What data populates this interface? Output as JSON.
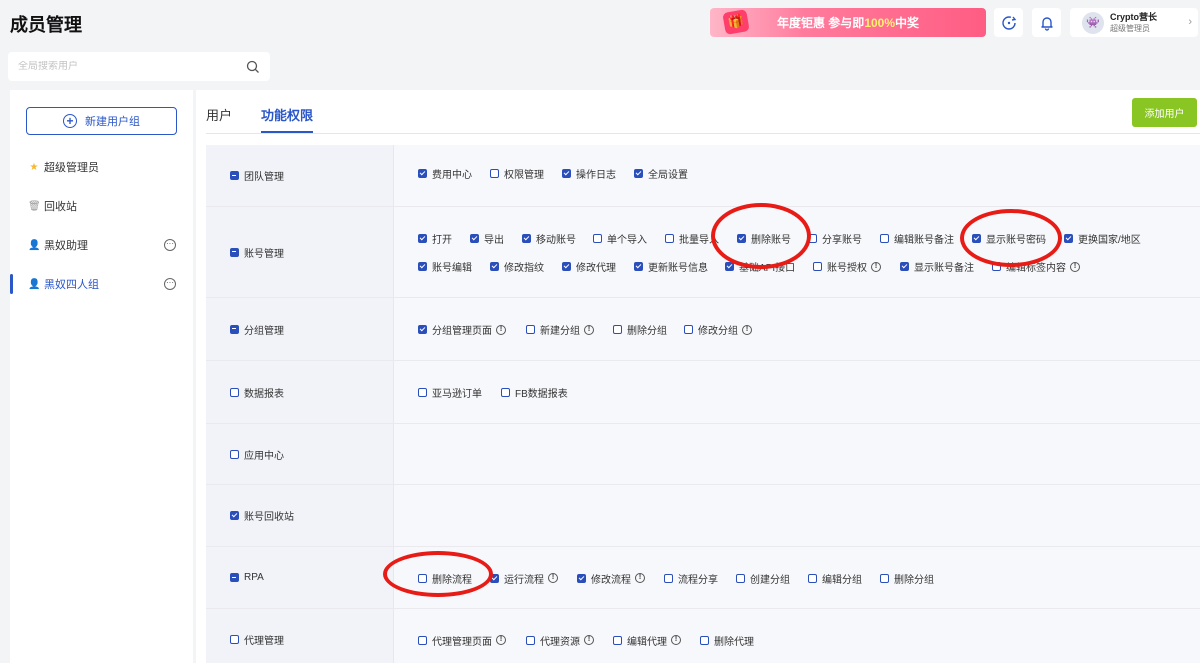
{
  "header": {
    "title": "成员管理",
    "promo": {
      "gift": "🎁",
      "part1": "年度钜惠 参与即",
      "highlight": "100%",
      "part2": "中奖"
    },
    "icons": [
      "refresh-icon",
      "bell-icon"
    ],
    "user": {
      "avatar": "👾",
      "name": "Crypto营长",
      "role": "超级管理员",
      "chevron": "›"
    }
  },
  "search": {
    "placeholder": "全局搜索用户",
    "value": ""
  },
  "sidebar": {
    "new_group_plus": "+",
    "new_group": "新建用户组",
    "items": [
      {
        "label": "超级管理员",
        "icon": "★",
        "more": false
      },
      {
        "label": "回收站",
        "icon": "🗑",
        "more": false
      },
      {
        "label": "黑奴助理",
        "icon": "👤",
        "more": true
      },
      {
        "label": "黑奴四人组",
        "icon": "👤",
        "more": true,
        "active": true
      }
    ],
    "more_glyph": "···"
  },
  "tabs": [
    {
      "label": "用户",
      "active": false
    },
    {
      "label": "功能权限",
      "active": true
    }
  ],
  "add_user": "添加用户",
  "info_glyph": "!",
  "permissions": [
    {
      "group": "团队管理",
      "state": "partial",
      "items": [
        {
          "label": "费用中心",
          "checked": true
        },
        {
          "label": "权限管理",
          "checked": false
        },
        {
          "label": "操作日志",
          "checked": true
        },
        {
          "label": "全局设置",
          "checked": true
        }
      ]
    },
    {
      "group": "账号管理",
      "state": "partial",
      "items": [
        {
          "label": "打开",
          "checked": true
        },
        {
          "label": "导出",
          "checked": true
        },
        {
          "label": "移动账号",
          "checked": true
        },
        {
          "label": "单个导入",
          "checked": false
        },
        {
          "label": "批量导入",
          "checked": false
        },
        {
          "label": "删除账号",
          "checked": true
        },
        {
          "label": "分享账号",
          "checked": false
        },
        {
          "label": "编辑账号备注",
          "checked": false
        },
        {
          "label": "显示账号密码",
          "checked": true
        },
        {
          "label": "更换国家/地区",
          "checked": true
        },
        {
          "label": "账号编辑",
          "checked": true
        },
        {
          "label": "修改指纹",
          "checked": true
        },
        {
          "label": "修改代理",
          "checked": true
        },
        {
          "label": "更新账号信息",
          "checked": true
        },
        {
          "label": "基础API接口",
          "checked": true
        },
        {
          "label": "账号授权",
          "checked": false,
          "info": true
        },
        {
          "label": "显示账号备注",
          "checked": true
        },
        {
          "label": "编辑标签内容",
          "checked": false,
          "info": true
        }
      ]
    },
    {
      "group": "分组管理",
      "state": "partial",
      "items": [
        {
          "label": "分组管理页面",
          "checked": true,
          "info": true
        },
        {
          "label": "新建分组",
          "checked": false,
          "info": true
        },
        {
          "label": "删除分组",
          "checked": false
        },
        {
          "label": "修改分组",
          "checked": false,
          "info": true
        }
      ]
    },
    {
      "group": "数据报表",
      "state": "unchecked",
      "items": [
        {
          "label": "亚马逊订单",
          "checked": false
        },
        {
          "label": "FB数据报表",
          "checked": false
        }
      ]
    },
    {
      "group": "应用中心",
      "state": "unchecked",
      "items": []
    },
    {
      "group": "账号回收站",
      "state": "checked",
      "items": []
    },
    {
      "group": "RPA",
      "state": "partial",
      "items": [
        {
          "label": "删除流程",
          "checked": false
        },
        {
          "label": "运行流程",
          "checked": true,
          "info": true
        },
        {
          "label": "修改流程",
          "checked": true,
          "info": true
        },
        {
          "label": "流程分享",
          "checked": false
        },
        {
          "label": "创建分组",
          "checked": false
        },
        {
          "label": "编辑分组",
          "checked": false
        },
        {
          "label": "删除分组",
          "checked": false
        }
      ]
    },
    {
      "group": "代理管理",
      "state": "unchecked",
      "items": [
        {
          "label": "代理管理页面",
          "checked": false,
          "info": true
        },
        {
          "label": "代理资源",
          "checked": false,
          "info": true
        },
        {
          "label": "编辑代理",
          "checked": false,
          "info": true
        },
        {
          "label": "删除代理",
          "checked": false
        }
      ]
    }
  ],
  "colors": {
    "accent": "#2b57c9",
    "add_button": "#8ac623",
    "annotation": "#e81c17"
  }
}
